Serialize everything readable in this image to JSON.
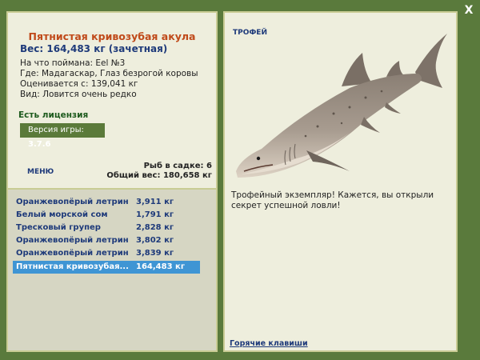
{
  "window": {
    "close_label": "X"
  },
  "fish": {
    "title": "Пятнистая кривозубая акула",
    "weight": "Вес: 164,483 кг (зачетная)",
    "bait": "На что поймана: Eel №3",
    "location": "Где: Мадагаскар, Глаз безрогой коровы",
    "value": "Оценивается с: 139,041 кг",
    "kind": "Вид: Ловится очень редко"
  },
  "license": "Есть лицензия",
  "version": {
    "label": "Версия игры: ",
    "number": "3.7.6"
  },
  "menu_label": "МЕНЮ",
  "stats": {
    "fish_in_cage": "Рыб в садке: 6",
    "total_weight": "Общий вес: 180,658 кг"
  },
  "catch_list": [
    {
      "name": "Оранжевопёрый летрин",
      "weight": "3,911 кг"
    },
    {
      "name": "Белый морской сом",
      "weight": "1,791 кг"
    },
    {
      "name": "Тресковый групер",
      "weight": "2,828 кг"
    },
    {
      "name": "Оранжевопёрый летрин",
      "weight": "3,802 кг"
    },
    {
      "name": "Оранжевопёрый летрин",
      "weight": "3,839 кг"
    },
    {
      "name": "Пятнистая кривозубая...",
      "weight": "164,483 кг",
      "selected": true
    }
  ],
  "trophy": {
    "label": "ТРОФЕЙ",
    "message": "Трофейный экземпляр! Кажется, вы открыли секрет успешной ловли!"
  },
  "hotkeys_label": "Горячие клавиши",
  "colors": {
    "frame": "#5a7a3c",
    "panel": "#eeeedd",
    "title_orange": "#c04a1a",
    "link_blue": "#1e3a7a",
    "selected_row": "#3f95d4"
  }
}
